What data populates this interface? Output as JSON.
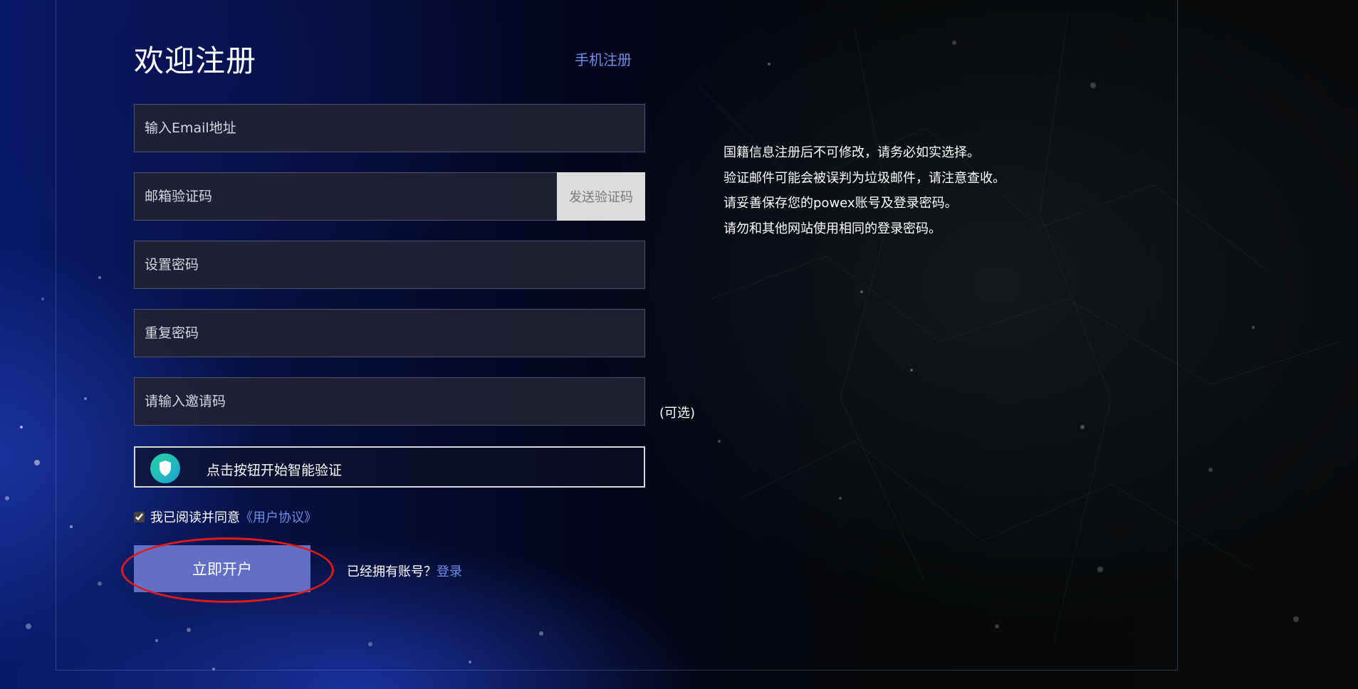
{
  "form": {
    "title": "欢迎注册",
    "phone_register_link": "手机注册",
    "email_placeholder": "输入Email地址",
    "email_code_placeholder": "邮箱验证码",
    "send_code_label": "发送验证码",
    "password_placeholder": "设置密码",
    "repeat_password_placeholder": "重复密码",
    "invite_code_placeholder": "请输入邀请码",
    "invite_optional_label": "(可选)",
    "captcha_label": "点击按钮开始智能验证",
    "agree_checked": true,
    "agree_text": "我已阅读并同意",
    "agreement_link": "《用户协议》",
    "submit_label": "立即开户",
    "have_account_text": "已经拥有账号？",
    "login_link": "登录"
  },
  "notes": [
    "国籍信息注册后不可修改，请务必如实选择。",
    "验证邮件可能会被误判为垃圾邮件，请注意查收。",
    "请妥善保存您的powex账号及登录密码。",
    "请勿和其他网站使用相同的登录密码。"
  ],
  "colors": {
    "accent_link": "#6f8ee8",
    "submit_button": "#6170c4",
    "annotation_circle": "#e01a1a"
  },
  "icons": {
    "captcha": "shield-icon",
    "agree": "checkbox"
  }
}
